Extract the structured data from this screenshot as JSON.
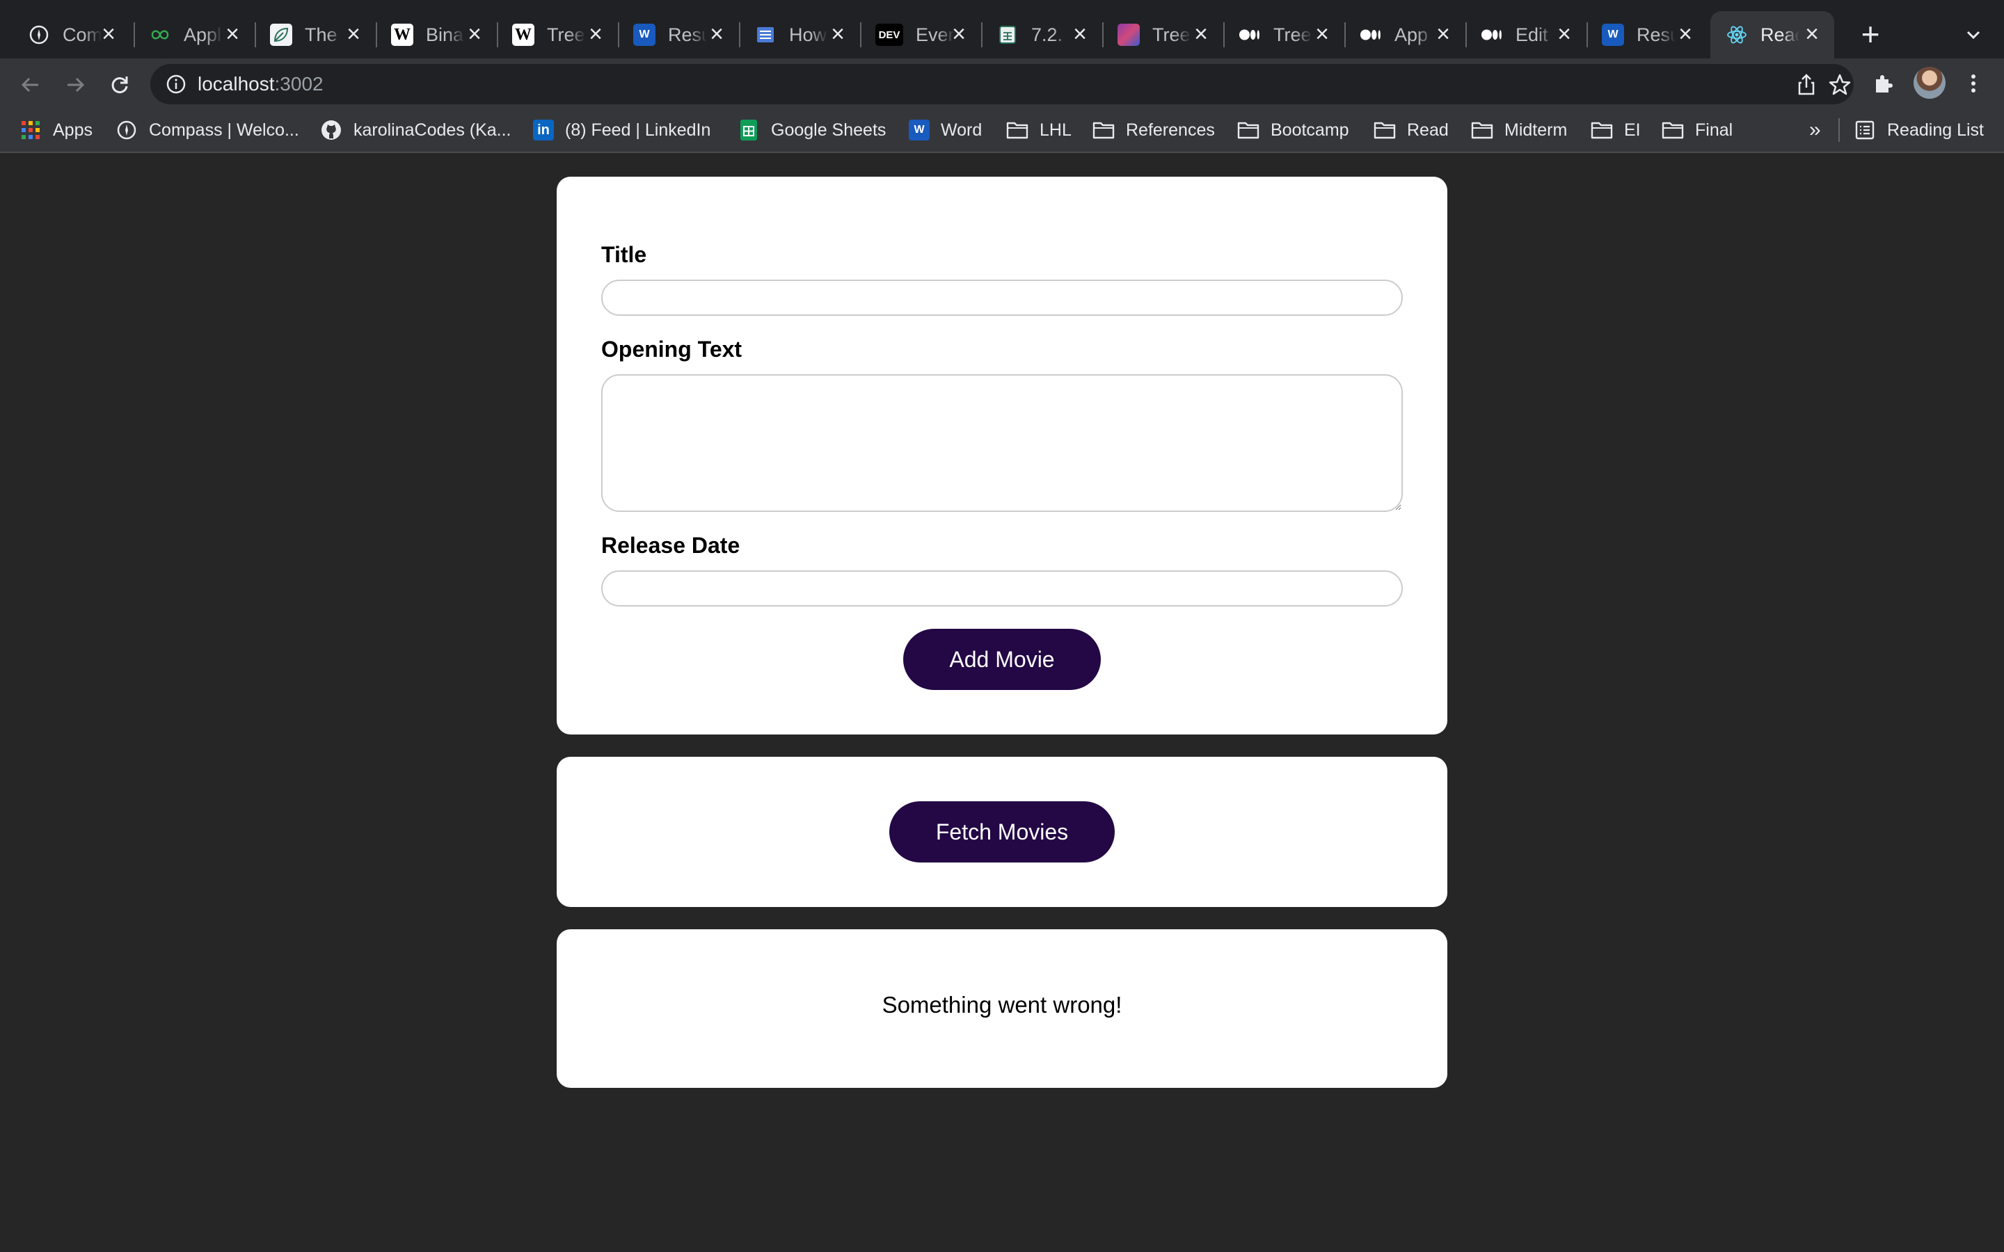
{
  "browser": {
    "tabs": [
      {
        "title": "Com",
        "icon": "compass-icon"
      },
      {
        "title": "Appl",
        "icon": "infinity-icon"
      },
      {
        "title": "The",
        "icon": "leaf-icon"
      },
      {
        "title": "Bina",
        "icon": "wikipedia-icon"
      },
      {
        "title": "Tree",
        "icon": "wikipedia-icon"
      },
      {
        "title": "Resu",
        "icon": "word-icon"
      },
      {
        "title": "How",
        "icon": "document-lines-icon"
      },
      {
        "title": "Even",
        "icon": "dev-icon"
      },
      {
        "title": "7.2.",
        "icon": "spreadsheet-icon"
      },
      {
        "title": "Tree",
        "icon": "image-icon"
      },
      {
        "title": "Tree",
        "icon": "medium-icon"
      },
      {
        "title": "App",
        "icon": "medium-icon"
      },
      {
        "title": "Edit",
        "icon": "medium-icon"
      },
      {
        "title": "Resu",
        "icon": "word-icon"
      },
      {
        "title": "Reac",
        "icon": "react-icon",
        "active": true
      }
    ],
    "dev_label": "DEV",
    "word_label": "W",
    "url_host": "localhost",
    "url_port": ":3002",
    "bookmarks": [
      {
        "label": "Apps",
        "icon": "apps-grid-icon"
      },
      {
        "label": "Compass | Welco...",
        "icon": "compass-icon"
      },
      {
        "label": "karolinaCodes (Ka...",
        "icon": "github-icon"
      },
      {
        "label": "(8) Feed | LinkedIn",
        "icon": "linkedin-icon"
      },
      {
        "label": "Google Sheets",
        "icon": "sheets-icon"
      },
      {
        "label": "Word",
        "icon": "word-icon"
      },
      {
        "label": "LHL",
        "icon": "folder-icon"
      },
      {
        "label": "References",
        "icon": "folder-icon"
      },
      {
        "label": "Bootcamp",
        "icon": "folder-icon"
      },
      {
        "label": "Read",
        "icon": "folder-icon"
      },
      {
        "label": "Midterm",
        "icon": "folder-icon"
      },
      {
        "label": "EI",
        "icon": "folder-icon"
      },
      {
        "label": "Final",
        "icon": "folder-icon"
      }
    ],
    "bookmarks_overflow": "»",
    "linkedin_label": "in",
    "reading_list": "Reading List"
  },
  "form": {
    "title_label": "Title",
    "title_value": "",
    "opening_text_label": "Opening Text",
    "opening_text_value": "",
    "release_date_label": "Release Date",
    "release_date_value": "",
    "submit_label": "Add Movie"
  },
  "fetch": {
    "button_label": "Fetch Movies"
  },
  "status": {
    "message": "Something went wrong!"
  },
  "colors": {
    "page_background": "#262626",
    "button_background": "#230845",
    "button_text": "#ffffff",
    "card_background": "#ffffff"
  }
}
